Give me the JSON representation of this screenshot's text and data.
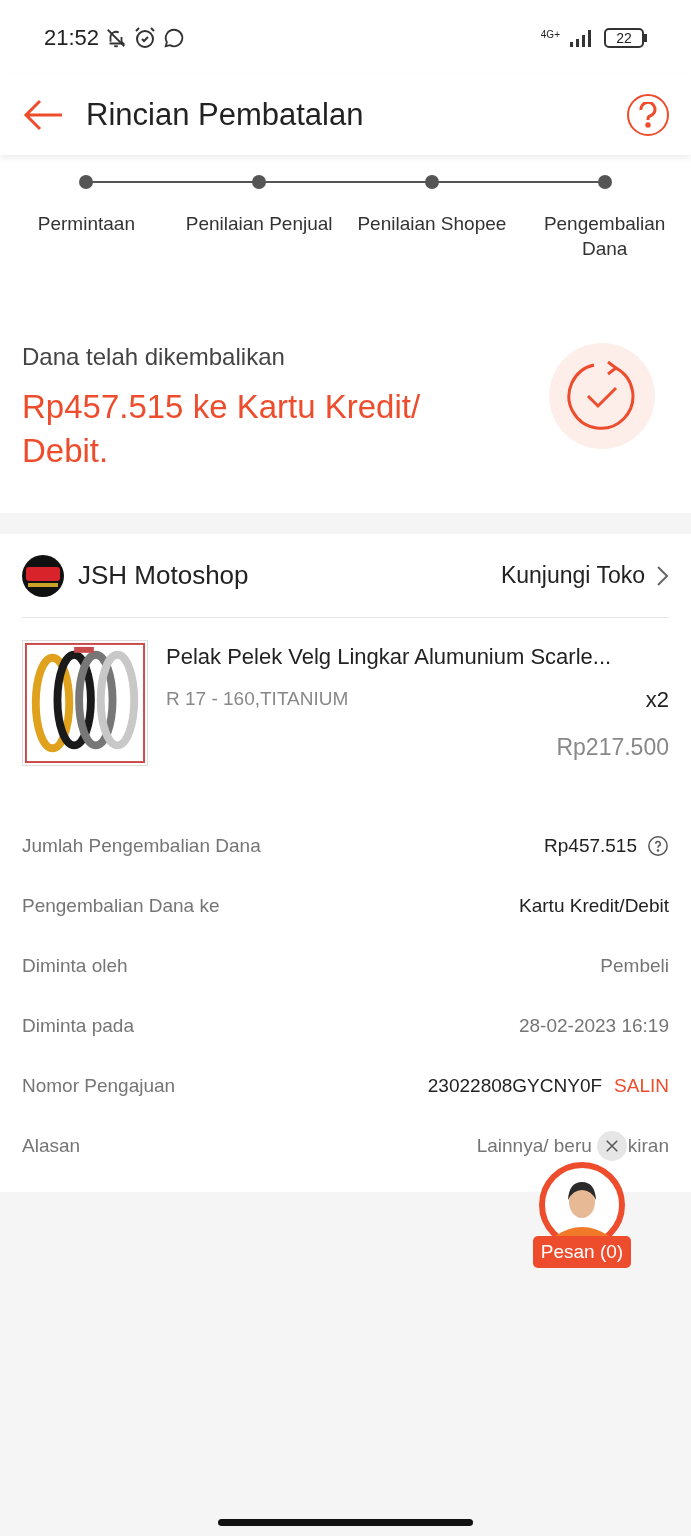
{
  "status_bar": {
    "time": "21:52",
    "network": "4G+",
    "battery": "22"
  },
  "header": {
    "title": "Rincian Pembatalan"
  },
  "steps": [
    {
      "label": "Permintaan"
    },
    {
      "label": "Penilaian Penjual"
    },
    {
      "label": "Penilaian Shopee"
    },
    {
      "label": "Pengembalian Dana"
    }
  ],
  "refund": {
    "status": "Dana telah dikembalikan",
    "amount": "Rp457.515 ke Kartu Kredit/ Debit."
  },
  "shop": {
    "name": "JSH Motoshop",
    "link": "Kunjungi Toko"
  },
  "product": {
    "kind": "picture",
    "name": "Pelak Pelek Velg Lingkar Alumunium Scarle...",
    "variant": "R 17 - 160,TITANIUM",
    "quantity": "x2",
    "price": "Rp217.500"
  },
  "details": [
    {
      "label": "Jumlah Pengembalian Dana",
      "value": "Rp457.515",
      "kind": "info"
    },
    {
      "label": "Pengembalian Dana ke",
      "value": "Kartu Kredit/Debit",
      "kind": "strong"
    },
    {
      "label": "Diminta oleh",
      "value": "Pembeli",
      "kind": "plain"
    },
    {
      "label": "Diminta pada",
      "value": "28-02-2023 16:19",
      "kind": "plain"
    },
    {
      "label": "Nomor Pengajuan",
      "value": "23022808GYCNY0F",
      "action": "SALIN",
      "kind": "copy"
    },
    {
      "label": "Alasan",
      "value_parts": [
        "Lainnya/ beru",
        "kiran"
      ],
      "kind": "covered"
    }
  ],
  "chat": {
    "label": "Pesan (0)"
  }
}
